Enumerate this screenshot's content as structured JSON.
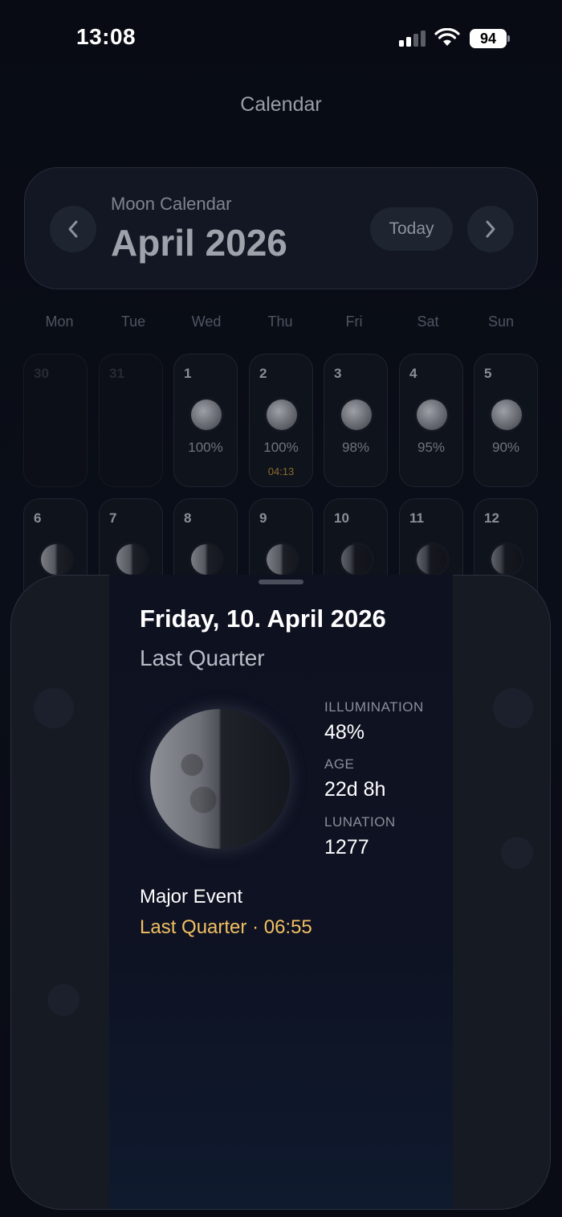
{
  "status_bar": {
    "time": "13:08",
    "battery": "94"
  },
  "nav": {
    "title": "Calendar"
  },
  "header": {
    "subtitle": "Moon Calendar",
    "title": "April 2026",
    "today_label": "Today"
  },
  "weekdays": [
    "Mon",
    "Tue",
    "Wed",
    "Thu",
    "Fri",
    "Sat",
    "Sun"
  ],
  "week1": [
    {
      "day": "30",
      "pct": "",
      "event": ""
    },
    {
      "day": "31",
      "pct": "",
      "event": ""
    },
    {
      "day": "1",
      "pct": "100%",
      "event": ""
    },
    {
      "day": "2",
      "pct": "100%",
      "event": "04:13"
    },
    {
      "day": "3",
      "pct": "98%",
      "event": ""
    },
    {
      "day": "4",
      "pct": "95%",
      "event": ""
    },
    {
      "day": "5",
      "pct": "90%",
      "event": ""
    }
  ],
  "week2": [
    {
      "day": "6"
    },
    {
      "day": "7"
    },
    {
      "day": "8"
    },
    {
      "day": "9"
    },
    {
      "day": "10"
    },
    {
      "day": "11"
    },
    {
      "day": "12"
    }
  ],
  "detail": {
    "date": "Friday, 10. April 2026",
    "phase": "Last Quarter",
    "illumination_label": "ILLUMINATION",
    "illumination": "48%",
    "age_label": "AGE",
    "age": "22d 8h",
    "lunation_label": "LUNATION",
    "lunation": "1277",
    "event_title": "Major Event",
    "event_value": "Last Quarter · 06:55"
  },
  "colors": {
    "accent_event": "#f2c062",
    "background": "#07090f"
  }
}
